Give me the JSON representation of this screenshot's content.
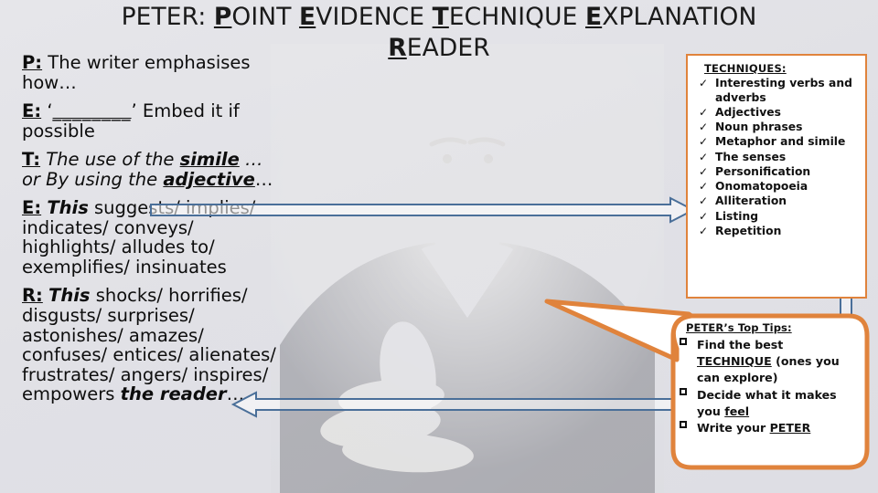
{
  "slide": {
    "background_color": "#e3e3e8",
    "accent_orange": "#e0833c",
    "arrow_blue": "#4a6f99"
  },
  "title": {
    "line1_prefix": "PETER: ",
    "words": [
      {
        "initial": "P",
        "rest": "OINT"
      },
      {
        "initial": "E",
        "rest": "VIDENCE"
      },
      {
        "initial": "T",
        "rest": "ECHNIQUE"
      },
      {
        "initial": "E",
        "rest": "XPLANATION"
      },
      {
        "initial": "R",
        "rest": "EADER"
      }
    ],
    "full_text": "PETER: POINT EVIDENCE TECHNIQUE EXPLANATION READER"
  },
  "body": {
    "point": {
      "label": "P:",
      "text": " The writer emphasises how…"
    },
    "evidence": {
      "label": "E:",
      "quote_open": "‘",
      "blank": "________",
      "quote_close": "’",
      "text": " Embed it if possible"
    },
    "technique": {
      "label": "T:",
      "text_a": "The use of the ",
      "keyword_a": "simile",
      "text_b": " … or By using the ",
      "keyword_b": "adjective",
      "text_c": "…"
    },
    "explanation": {
      "label": "E:",
      "keyword": "This",
      "text": " suggests/ implies/ indicates/ conveys/ highlights/ alludes to/ exemplifies/ insinuates"
    },
    "reader": {
      "label": "R:",
      "keyword": "This",
      "text": " shocks/ horrifies/ disgusts/ surprises/ astonishes/ amazes/ confuses/ entices/ alienates/ frustrates/ angers/ inspires/ empowers ",
      "keyword_end": "the reader",
      "ellipsis": "…"
    }
  },
  "techniques_box": {
    "title": "TECHNIQUES:",
    "bullet_glyph": "✓",
    "items": [
      "Interesting verbs and adverbs",
      "Adjectives",
      "Noun phrases",
      "Metaphor and simile",
      "The senses",
      "Personification",
      "Onomatopoeia",
      "Alliteration",
      "Listing",
      "Repetition"
    ]
  },
  "tips_bubble": {
    "title": "PETER’s Top Tips:",
    "items": [
      {
        "pre": "Find the ",
        "bold": "best",
        "mid": " ",
        "underline": "TECHNIQUE",
        "post": " (ones you can explore)"
      },
      {
        "pre": "Decide what it makes you ",
        "bold": "",
        "mid": "",
        "underline": "feel",
        "post": ""
      },
      {
        "pre": "Write your ",
        "bold": "",
        "mid": "",
        "underline": "PETER",
        "post": ""
      }
    ]
  },
  "arrows": [
    {
      "name": "technique-to-techniques-box",
      "direction": "right"
    },
    {
      "name": "reader-from-tips-bubble",
      "direction": "left"
    },
    {
      "name": "tips-to-techniques-box",
      "direction": "up"
    }
  ]
}
